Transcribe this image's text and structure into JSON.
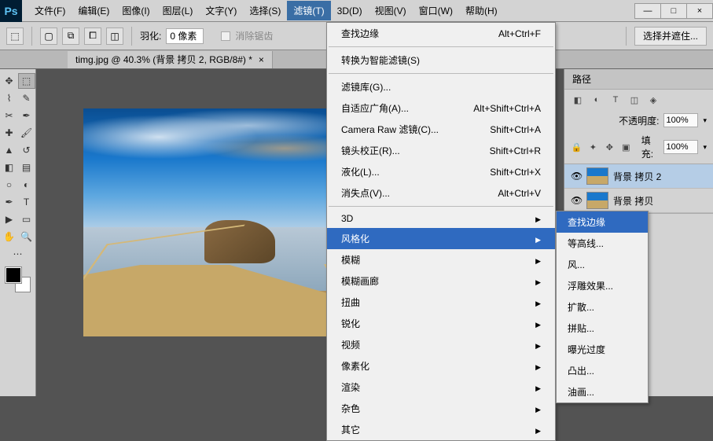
{
  "menu": [
    "文件(F)",
    "编辑(E)",
    "图像(I)",
    "图层(L)",
    "文字(Y)",
    "选择(S)",
    "滤镜(T)",
    "3D(D)",
    "视图(V)",
    "窗口(W)",
    "帮助(H)"
  ],
  "menu_active_index": 6,
  "win_controls": {
    "min": "—",
    "max": "□",
    "close": "×"
  },
  "options": {
    "feather_label": "羽化:",
    "feather_value": "0 像素",
    "antialias": "消除锯齿",
    "select_mask": "选择并遮住..."
  },
  "doc_tab": {
    "title": "timg.jpg @ 40.3% (背景 拷贝 2, RGB/8#) *",
    "close": "×"
  },
  "dropdown": [
    {
      "t": "查找边缘",
      "s": "Alt+Ctrl+F"
    },
    {
      "sep": true
    },
    {
      "t": "转换为智能滤镜(S)"
    },
    {
      "sep": true
    },
    {
      "t": "滤镜库(G)..."
    },
    {
      "t": "自适应广角(A)...",
      "s": "Alt+Shift+Ctrl+A"
    },
    {
      "t": "Camera Raw 滤镜(C)...",
      "s": "Shift+Ctrl+A"
    },
    {
      "t": "镜头校正(R)...",
      "s": "Shift+Ctrl+R"
    },
    {
      "t": "液化(L)...",
      "s": "Shift+Ctrl+X"
    },
    {
      "t": "消失点(V)...",
      "s": "Alt+Ctrl+V"
    },
    {
      "sep": true
    },
    {
      "t": "3D",
      "sub": true
    },
    {
      "t": "风格化",
      "sub": true,
      "hl": true
    },
    {
      "t": "模糊",
      "sub": true
    },
    {
      "t": "模糊画廊",
      "sub": true
    },
    {
      "t": "扭曲",
      "sub": true
    },
    {
      "t": "锐化",
      "sub": true
    },
    {
      "t": "视频",
      "sub": true
    },
    {
      "t": "像素化",
      "sub": true
    },
    {
      "t": "渲染",
      "sub": true
    },
    {
      "t": "杂色",
      "sub": true
    },
    {
      "t": "其它",
      "sub": true
    }
  ],
  "submenu": [
    {
      "t": "查找边缘",
      "hl": true
    },
    {
      "t": "等高线..."
    },
    {
      "t": "风..."
    },
    {
      "t": "浮雕效果..."
    },
    {
      "t": "扩散..."
    },
    {
      "t": "拼贴..."
    },
    {
      "t": "曝光过度"
    },
    {
      "t": "凸出..."
    },
    {
      "t": "油画..."
    }
  ],
  "right": {
    "tab": "路径",
    "opacity_label": "不透明度:",
    "opacity": "100%",
    "fill_label": "填充:",
    "fill": "100%",
    "layers": [
      {
        "name": "背景 拷贝 2",
        "sel": true
      },
      {
        "name": "背景 拷贝"
      }
    ],
    "lock": "🔒"
  }
}
